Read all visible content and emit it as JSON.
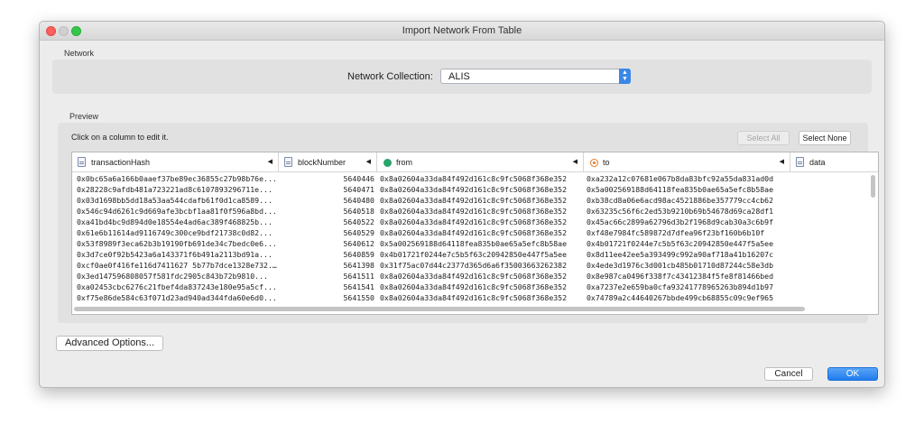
{
  "window": {
    "title": "Import Network From Table"
  },
  "network": {
    "section_label": "Network",
    "collection_label": "Network Collection:",
    "collection_value": "ALIS"
  },
  "preview": {
    "section_label": "Preview",
    "hint": "Click on a column to edit it.",
    "select_all": "Select All",
    "select_none": "Select None",
    "columns": [
      {
        "label": "transactionHash",
        "icon": "text-column-icon"
      },
      {
        "label": "blockNumber",
        "icon": "text-column-icon"
      },
      {
        "label": "from",
        "icon": "source-node-icon"
      },
      {
        "label": "to",
        "icon": "target-node-icon"
      },
      {
        "label": "data",
        "icon": "text-column-icon"
      }
    ],
    "rows": [
      [
        "0x0bc65a6a166b0aaef37be89ec36855c27b98b76e...",
        "5640446",
        "0x8a02604a33da84f492d161c8c9fc5068f368e352",
        "0xa232a12c07681e067b8da83bfc92a55da831ad0d"
      ],
      [
        "0x28228c9afdb481a723221ad8c6107893296711e...",
        "5640471",
        "0x8a02604a33da84f492d161c8c9fc5068f368e352",
        "0x5a002569188d64118fea835b0ae65a5efc8b58ae"
      ],
      [
        "0x03d1698bb5dd18a53aa544cdafb61f0d1ca8589...",
        "5640480",
        "0x8a02604a33da84f492d161c8c9fc5068f368e352",
        "0xb38cd8a06e6acd98ac4521886be357779cc4cb62"
      ],
      [
        "0x546c94d6261c9d669afe3bcbf1aa81f0f596a8bd...",
        "5640518",
        "0x8a02604a33da84f492d161c8c9fc5068f368e352",
        "0x63235c56f6c2ed53b9210b69b54678d69ca28df1"
      ],
      [
        "0xa41bd4bc9d894d0e18554e4ad6ac389f468825b...",
        "5640522",
        "0x8a02604a33da84f492d161c8c9fc5068f368e352",
        "0x45ac66c2899a62796d3b2f1968d9cab30a3c6b9f"
      ],
      [
        "0x61e6b11614ad9116749c300ce9bdf21738c0d82...",
        "5640529",
        "0x8a02604a33da84f492d161c8c9fc5068f368e352",
        "0xf48e7984fc589872d7dfea96f23bf160b6b10f"
      ],
      [
        "0x53f8989f3eca62b3b19190fb691de34c7bedc0e6...",
        "5640612",
        "0x5a002569188d64118fea835b0ae65a5efc8b58ae",
        "0x4b01721f0244e7c5b5f63c20942850e447f5a5ee"
      ],
      [
        "0x3d7ce0f92b5423a6a143371f6b491a2113bd91a...",
        "5640859",
        "0x4b01721f0244e7c5b5f63c20942850e447f5a5ee",
        "0x8d11ee42ee5a393499c992a90af718a41b16207c"
      ],
      [
        "0xcf0ae0f416fe116d7411627 5b77b7dce1328e732...",
        "5641398",
        "0x31f75ac07d44c2377d365d6a6f35003663262382",
        "0x4ede3d1976c3d001cb485b01710d87244c58e3db"
      ],
      [
        "0x3ed147596808057f581fdc2905c843b72b9810...",
        "5641511",
        "0x8a02604a33da84f492d161c8c9fc5068f368e352",
        "0x8e987ca0496f338f7c43412384f5fe8f81466bed"
      ],
      [
        "0xa02453cbc6276c21fbef4da837243e180e95a5cf...",
        "5641541",
        "0x8a02604a33da84f492d161c8c9fc5068f368e352",
        "0xa7237e2e659ba0cfa93241778965263b894d1b97"
      ],
      [
        "0xf75e86de584c63f071d23ad940ad344fda60e6d0...",
        "5641550",
        "0x8a02604a33da84f492d161c8c9fc5068f368e352",
        "0x74789a2c44640267bbde499cb68855c09c9ef965"
      ]
    ]
  },
  "footer": {
    "advanced_options": "Advanced Options...",
    "cancel": "Cancel",
    "ok": "OK"
  },
  "colors": {
    "ok_button": "#1f7bec",
    "source_icon": "#2aa56b",
    "target_icon": "#e47b24"
  }
}
